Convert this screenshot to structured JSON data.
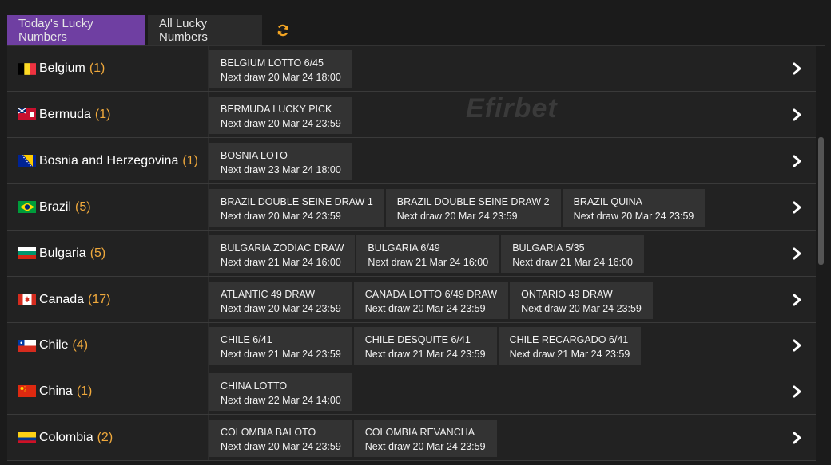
{
  "tabs": {
    "today": "Today's Lucky Numbers",
    "all": "All Lucky Numbers"
  },
  "watermark": "Efirbet",
  "colors": {
    "accent": "#6f3fa2",
    "count": "#f0a93c",
    "refresh": "#f5a623"
  },
  "rows": [
    {
      "country": "Belgium",
      "count": "(1)",
      "flag": "belgium-flag",
      "draws": [
        {
          "name": "BELGIUM LOTTO 6/45",
          "next": "Next draw 20 Mar 24 18:00"
        }
      ]
    },
    {
      "country": "Bermuda",
      "count": "(1)",
      "flag": "bermuda-flag",
      "draws": [
        {
          "name": "BERMUDA LUCKY PICK",
          "next": "Next draw 20 Mar 24 23:59"
        }
      ]
    },
    {
      "country": "Bosnia and Herzegovina",
      "count": "(1)",
      "flag": "bosnia-flag",
      "draws": [
        {
          "name": "BOSNIA LOTO",
          "next": "Next draw 23 Mar 24 18:00"
        }
      ]
    },
    {
      "country": "Brazil",
      "count": "(5)",
      "flag": "brazil-flag",
      "draws": [
        {
          "name": "BRAZIL DOUBLE SEINE DRAW 1",
          "next": "Next draw 20 Mar 24 23:59"
        },
        {
          "name": "BRAZIL DOUBLE SEINE DRAW 2",
          "next": "Next draw 20 Mar 24 23:59"
        },
        {
          "name": "BRAZIL QUINA",
          "next": "Next draw 20 Mar 24 23:59"
        }
      ]
    },
    {
      "country": "Bulgaria",
      "count": "(5)",
      "flag": "bulgaria-flag",
      "draws": [
        {
          "name": "BULGARIA ZODIAC DRAW",
          "next": "Next draw 21 Mar 24 16:00"
        },
        {
          "name": "BULGARIA 6/49",
          "next": "Next draw 21 Mar 24 16:00"
        },
        {
          "name": "BULGARIA 5/35",
          "next": "Next draw 21 Mar 24 16:00"
        }
      ]
    },
    {
      "country": "Canada",
      "count": "(17)",
      "flag": "canada-flag",
      "draws": [
        {
          "name": "ATLANTIC 49 DRAW",
          "next": "Next draw 20 Mar 24 23:59"
        },
        {
          "name": "CANADA LOTTO 6/49 DRAW",
          "next": "Next draw 20 Mar 24 23:59"
        },
        {
          "name": "ONTARIO 49 DRAW",
          "next": "Next draw 20 Mar 24 23:59"
        }
      ]
    },
    {
      "country": "Chile",
      "count": "(4)",
      "flag": "chile-flag",
      "draws": [
        {
          "name": "CHILE 6/41",
          "next": "Next draw 21 Mar 24 23:59"
        },
        {
          "name": "CHILE DESQUITE 6/41",
          "next": "Next draw 21 Mar 24 23:59"
        },
        {
          "name": "CHILE RECARGADO 6/41",
          "next": "Next draw 21 Mar 24 23:59"
        }
      ]
    },
    {
      "country": "China",
      "count": "(1)",
      "flag": "china-flag",
      "draws": [
        {
          "name": "CHINA LOTTO",
          "next": "Next draw 22 Mar 24 14:00"
        }
      ]
    },
    {
      "country": "Colombia",
      "count": "(2)",
      "flag": "colombia-flag",
      "draws": [
        {
          "name": "COLOMBIA BALOTO",
          "next": "Next draw 20 Mar 24 23:59"
        },
        {
          "name": "COLOMBIA REVANCHA",
          "next": "Next draw 20 Mar 24 23:59"
        }
      ]
    }
  ]
}
